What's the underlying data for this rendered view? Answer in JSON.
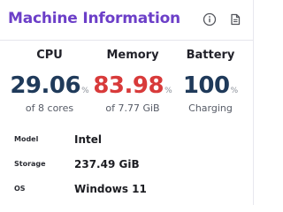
{
  "header": {
    "title": "Machine Information",
    "icons": [
      "info-icon",
      "document-icon"
    ],
    "accent": "#6c3fc8"
  },
  "metrics": {
    "cpu": {
      "label": "CPU",
      "value": "29.06",
      "unit": "%",
      "sub": "of 8 cores"
    },
    "memory": {
      "label": "Memory",
      "value": "83.98",
      "unit": "%",
      "sub": "of 7.77 GiB",
      "color": "#d83a3a"
    },
    "battery": {
      "label": "Battery",
      "value": "100",
      "unit": "%",
      "sub": "Charging"
    }
  },
  "details": [
    {
      "key": "Model",
      "value": "Intel"
    },
    {
      "key": "Storage",
      "value": "237.49 GiB"
    },
    {
      "key": "OS",
      "value": "Windows 11"
    }
  ]
}
